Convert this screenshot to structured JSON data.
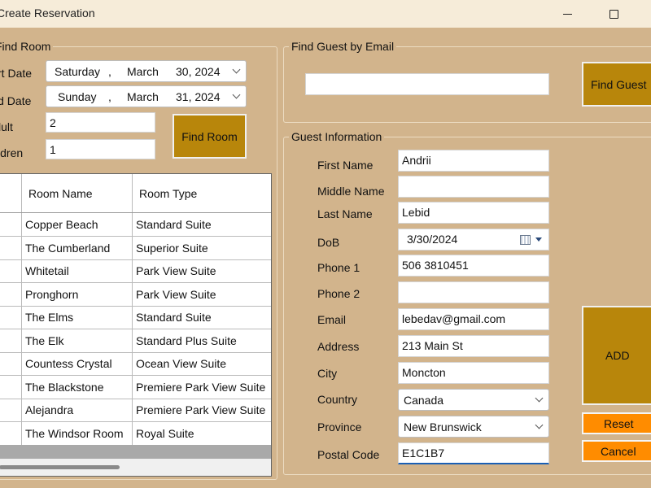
{
  "window": {
    "title": "Create Reservation"
  },
  "find_room": {
    "legend": "Find Room",
    "start_label": "Start Date",
    "end_label": "End Date",
    "adult_label": "Adult",
    "children_label": "Children",
    "start_date": {
      "weekday": "Saturday",
      "sep": ",",
      "month": "March",
      "day": "30, 2024"
    },
    "end_date": {
      "weekday": "Sunday",
      "sep": ",",
      "month": "March",
      "day": "31, 2024"
    },
    "adult_value": "2",
    "children_value": "1",
    "find_button": "Find Room"
  },
  "rooms_table": {
    "columns": [
      "Room Name",
      "Room Type"
    ],
    "rows": [
      [
        "Copper Beach",
        "Standard Suite"
      ],
      [
        "The Cumberland",
        "Superior Suite"
      ],
      [
        "Whitetail",
        "Park View Suite"
      ],
      [
        "Pronghorn",
        "Park View Suite"
      ],
      [
        "The Elms",
        "Standard Suite"
      ],
      [
        "The Elk",
        "Standard Plus Suite"
      ],
      [
        "Countess Crystal",
        "Ocean View Suite"
      ],
      [
        "The Blackstone",
        "Premiere Park View Suite"
      ],
      [
        "Alejandra",
        "Premiere Park View Suite"
      ],
      [
        "The Windsor Room",
        "Royal Suite"
      ]
    ]
  },
  "find_guest": {
    "legend": "Find Guest by Email",
    "email_value": "",
    "button": "Find Guest"
  },
  "guest_info": {
    "legend": "Guest Information",
    "first_name_label": "First Name",
    "first_name": "Andrii",
    "middle_name_label": "Middle Name",
    "middle_name": "",
    "last_name_label": "Last Name",
    "last_name": "Lebid",
    "dob_label": "DoB",
    "dob": "3/30/2024",
    "phone1_label": "Phone 1",
    "phone1": "506 3810451",
    "phone2_label": "Phone 2",
    "phone2": "",
    "email_label": "Email",
    "email": "lebedav@gmail.com",
    "address_label": "Address",
    "address": "213 Main St",
    "city_label": "City",
    "city": "Moncton",
    "country_label": "Country",
    "country": "Canada",
    "province_label": "Province",
    "province": "New Brunswick",
    "postal_label": "Postal Code",
    "postal": "E1C1B7"
  },
  "actions": {
    "add": "ADD",
    "reset": "Reset",
    "cancel": "Cancel"
  },
  "colors": {
    "background": "#d2b48c",
    "button_gold": "#b8860b",
    "button_orange": "#ff8c00"
  }
}
